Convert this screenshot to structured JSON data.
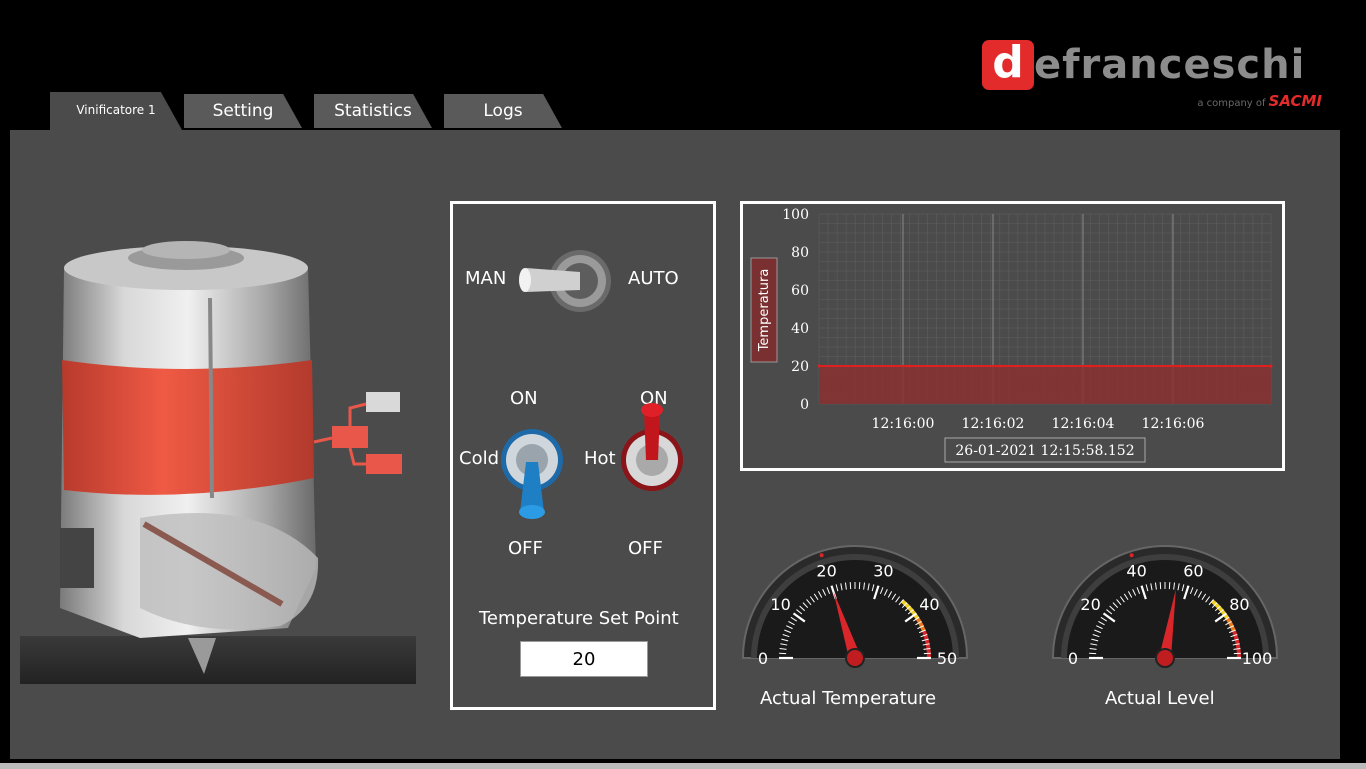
{
  "tabs": [
    {
      "label": "Vinificatore 1",
      "active": true
    },
    {
      "label": "Setting"
    },
    {
      "label": "Statistics"
    },
    {
      "label": "Logs"
    }
  ],
  "brand": {
    "logo_letter": "d",
    "name_rest": "efranceschi",
    "company_prefix": "a company of",
    "company": "SACMI"
  },
  "controls": {
    "mode_left": "MAN",
    "mode_right": "AUTO",
    "cold_label": "Cold",
    "hot_label": "Hot",
    "cold_on": "ON",
    "cold_off": "OFF",
    "hot_on": "ON",
    "hot_off": "OFF",
    "setpoint_label": "Temperature Set Point",
    "setpoint_value": "20"
  },
  "chart_data": {
    "type": "area",
    "ylabel": "Temperatura",
    "ylim": [
      0,
      100
    ],
    "yticks": [
      0,
      20,
      40,
      60,
      80,
      100
    ],
    "xticks": [
      "12:16:00",
      "12:16:02",
      "12:16:04",
      "12:16:06"
    ],
    "x": [
      "12:15:58",
      "12:16:00",
      "12:16:02",
      "12:16:04",
      "12:16:06",
      "12:16:08"
    ],
    "series": [
      {
        "values": [
          20,
          20,
          20,
          20,
          20,
          20
        ]
      }
    ],
    "grid": true,
    "timestamp": "26-01-2021  12:15:58.152",
    "colors": {
      "series": "#e02020",
      "fill": "#8a3030"
    }
  },
  "gauges": [
    {
      "label": "Actual Temperature",
      "ticks": [
        "0",
        "10",
        "20",
        "30",
        "40",
        "50"
      ],
      "min": 0,
      "max": 50,
      "value": 20
    },
    {
      "label": "Actual Level",
      "ticks": [
        "0",
        "20",
        "40",
        "60",
        "80",
        "100"
      ],
      "min": 0,
      "max": 100,
      "value": 55
    }
  ],
  "colors": {
    "accent": "#e32b2b",
    "panel": "#4b4b4b",
    "cold": "#1e7fc4",
    "hot": "#c0161c"
  }
}
